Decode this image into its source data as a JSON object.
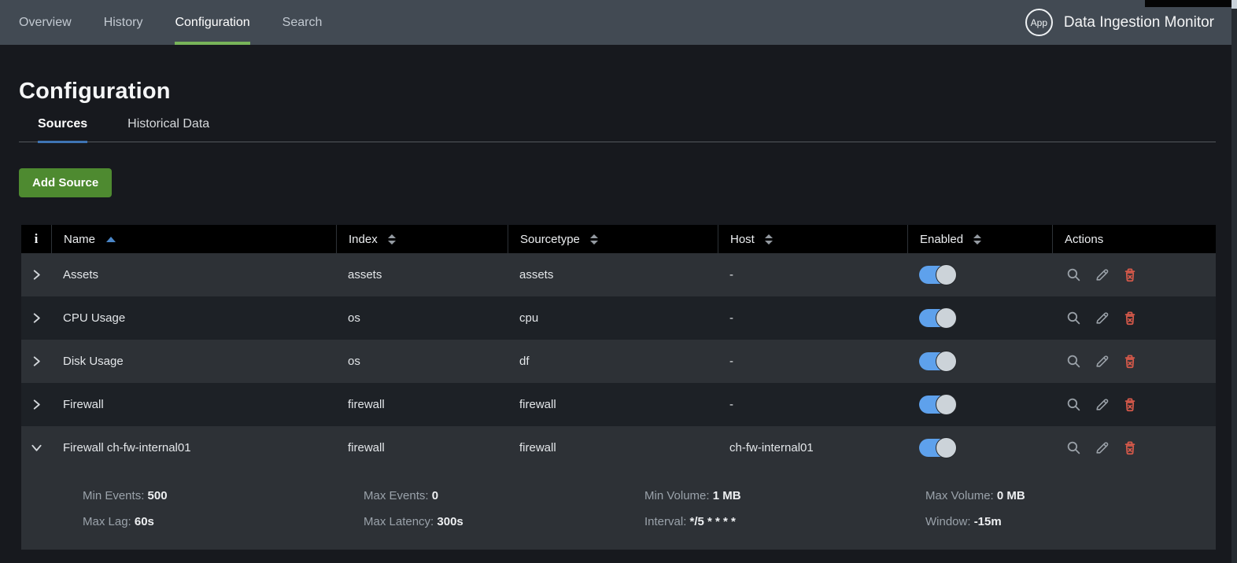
{
  "nav": {
    "items": [
      {
        "label": "Overview",
        "active": false
      },
      {
        "label": "History",
        "active": false
      },
      {
        "label": "Configuration",
        "active": true
      },
      {
        "label": "Search",
        "active": false
      }
    ],
    "app_badge": "App",
    "app_title": "Data Ingestion Monitor"
  },
  "page": {
    "title": "Configuration"
  },
  "tabs": [
    {
      "label": "Sources",
      "active": true
    },
    {
      "label": "Historical Data",
      "active": false
    }
  ],
  "toolbar": {
    "add_source_label": "Add Source"
  },
  "table": {
    "columns": [
      {
        "label": "i",
        "icon": "info-icon",
        "sort": "none"
      },
      {
        "label": "Name",
        "sort": "asc"
      },
      {
        "label": "Index",
        "sort": "both"
      },
      {
        "label": "Sourcetype",
        "sort": "both"
      },
      {
        "label": "Host",
        "sort": "both"
      },
      {
        "label": "Enabled",
        "sort": "both"
      },
      {
        "label": "Actions",
        "sort": "none"
      }
    ],
    "row_actions": [
      {
        "name": "search-icon"
      },
      {
        "name": "edit-icon"
      },
      {
        "name": "delete-icon"
      }
    ],
    "rows": [
      {
        "name": "Assets",
        "index": "assets",
        "sourcetype": "assets",
        "host": "-",
        "enabled": true,
        "expanded": false
      },
      {
        "name": "CPU Usage",
        "index": "os",
        "sourcetype": "cpu",
        "host": "-",
        "enabled": true,
        "expanded": false
      },
      {
        "name": "Disk Usage",
        "index": "os",
        "sourcetype": "df",
        "host": "-",
        "enabled": true,
        "expanded": false
      },
      {
        "name": "Firewall",
        "index": "firewall",
        "sourcetype": "firewall",
        "host": "-",
        "enabled": true,
        "expanded": false
      },
      {
        "name": "Firewall ch-fw-internal01",
        "index": "firewall",
        "sourcetype": "firewall",
        "host": "ch-fw-internal01",
        "enabled": true,
        "expanded": true,
        "details": [
          [
            {
              "label": "Min Events:",
              "value": "500"
            },
            {
              "label": "Max Events:",
              "value": "0"
            },
            {
              "label": "Min Volume:",
              "value": "1 MB"
            },
            {
              "label": "Max Volume:",
              "value": "0 MB"
            }
          ],
          [
            {
              "label": "Max Lag:",
              "value": "60s"
            },
            {
              "label": "Max Latency:",
              "value": "300s"
            },
            {
              "label": "Interval:",
              "value": "*/5 * * * *"
            },
            {
              "label": "Window:",
              "value": "-15m"
            }
          ]
        ]
      }
    ]
  },
  "colors": {
    "nav_background": "#424a53",
    "page_background": "#17191e",
    "nav_active_underline_green": "#78b45a",
    "add_button_green": "#4e8a30",
    "tab_active_underline_blue": "#3e74b4",
    "sort_asc_blue": "#4a86c8",
    "toggle_on_blue": "#5ea1ec",
    "row_light": "#2d3136",
    "row_dark": "#1d2126",
    "header_black": "#000000",
    "delete_red": "#d6594a",
    "icon_gray": "#9aa1a8"
  }
}
